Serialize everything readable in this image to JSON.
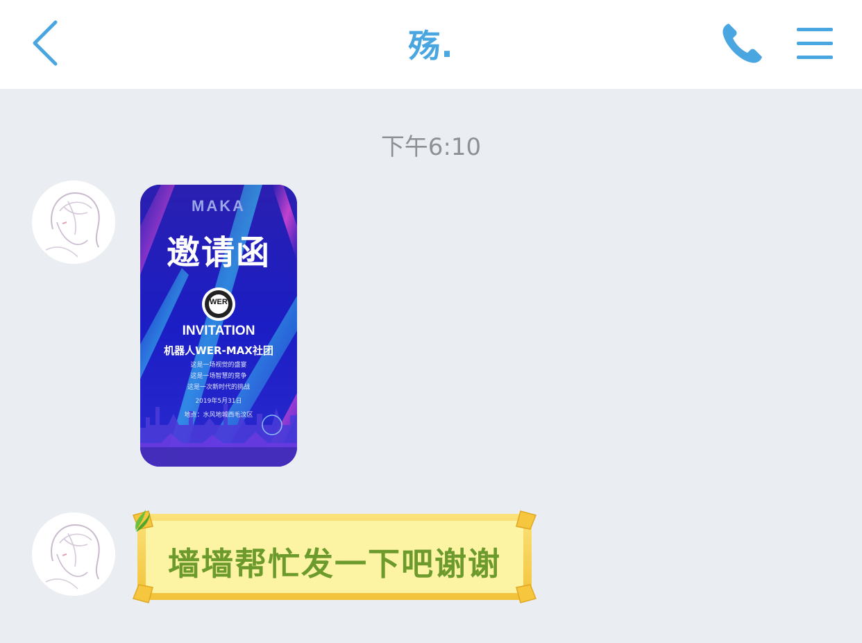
{
  "header": {
    "title": "殇.",
    "back_icon": "chevron-left-icon",
    "call_icon": "phone-icon",
    "menu_icon": "menu-icon",
    "accent_color": "#4aa6e0"
  },
  "chat": {
    "timestamp": "下午6:10",
    "messages": [
      {
        "type": "image",
        "image": {
          "brand": "MAKA",
          "title": "邀请函",
          "badge": "WER",
          "heading": "INVITATION",
          "club": "机器人WER-MAX社团",
          "lines": [
            "这是一场视觉的盛宴",
            "这是一场智慧的竞争",
            "这是一次新时代的挑战"
          ],
          "date": "2019年5月31日",
          "location": "地点：水风地城西毛汶区"
        }
      },
      {
        "type": "text",
        "text": "墙墙帮忙发一下吧谢谢",
        "bubble_color": "#fcf3a3",
        "text_color": "#6d9a2c"
      }
    ]
  }
}
